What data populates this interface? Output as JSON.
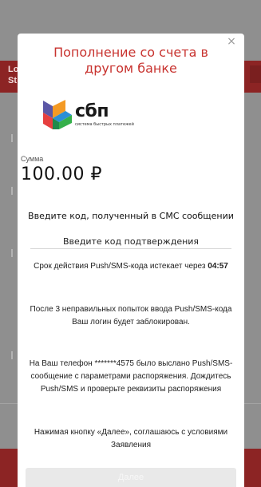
{
  "background": {
    "brand_text": "Lo\nSt",
    "accent_color": "#8c2424"
  },
  "modal": {
    "title": "Пополнение со счета в другом банке",
    "close_icon": "close-icon",
    "logo": {
      "name": "сбп",
      "subtitle": "система быстрых платежей"
    },
    "amount_label": "Сумма",
    "amount_value": "100.00 ₽",
    "code_prompt": "Введите код, полученный в СМС сообщении",
    "code_placeholder": "Введите код подтверждения",
    "expiry_text": "Срок действия Push/SMS-кода истекает через",
    "expiry_timer": "04:57",
    "attempts_warning": "После 3 неправильных попыток ввода Push/SMS-кода Ваш логин будет заблокирован.",
    "sent_notice": "На Ваш телефон *******4575 было выслано Push/SMS-сообщение с параметрами распоряжения. Дождитесь Push/SMS и проверьте реквизиты распоряжения",
    "agreement": "Нажимая кнопку «Далее», соглашаюсь с условиями Заявления",
    "next_button": "Далее",
    "accent_color": "#c8332f"
  }
}
